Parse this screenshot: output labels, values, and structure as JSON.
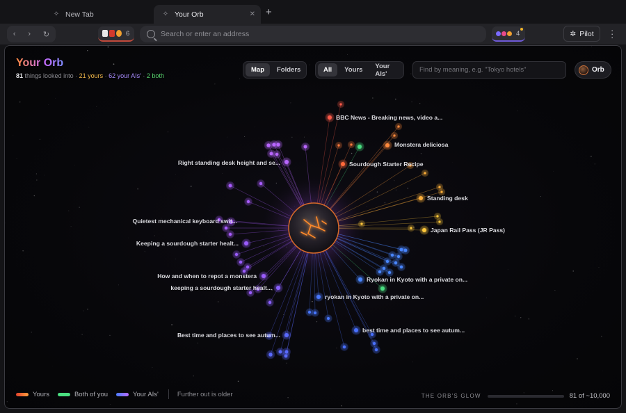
{
  "tabs": [
    {
      "label": "New Tab",
      "active": false,
      "icon": "sparkle-icon"
    },
    {
      "label": "Your Orb",
      "active": true,
      "icon": "sparkle-icon"
    }
  ],
  "toolbar": {
    "extension_count": "6",
    "address_placeholder": "Search or enter an address",
    "ai_count": "4",
    "pilot_label": "Pilot"
  },
  "header": {
    "title": "Your Orb",
    "count": "81",
    "count_label": "things looked into",
    "yours": "21 yours",
    "ais": "62 your AIs'",
    "both": "2 both"
  },
  "view_toggle": {
    "options": [
      "Map",
      "Folders"
    ],
    "selected": "Map"
  },
  "filter_toggle": {
    "options": [
      "All",
      "Yours",
      "Your AIs'"
    ],
    "selected": "All"
  },
  "search": {
    "placeholder": "Find by meaning, e.g. \"Tokyo hotels\""
  },
  "orb_button": {
    "label": "Orb"
  },
  "nodes": [
    {
      "label": "BBC News - Breaking news, video a...",
      "color": "#ff5a4a"
    },
    {
      "label": "Monstera deliciosa",
      "color": "#ff8a3d"
    },
    {
      "label": "Sourdough Starter Recipe",
      "color": "#ff6a3a"
    },
    {
      "label": "Standing desk",
      "color": "#ffb03a"
    },
    {
      "label": "Japan Rail Pass (JR Pass)",
      "color": "#ffc83a"
    },
    {
      "label": "Right standing desk height and se...",
      "color": "#b866ff"
    },
    {
      "label": "Quietest mechanical keyboard swit...",
      "color": "#a85cff"
    },
    {
      "label": "Keeping a sourdough starter healt...",
      "color": "#9a5cff"
    },
    {
      "label": "How and when to repot a monstera",
      "color": "#9a5cff"
    },
    {
      "label": "keeping a sourdough starter healt...",
      "color": "#8a60ff"
    },
    {
      "label": "Ryokan in Kyoto with a private on...",
      "color": "#4a86ff"
    },
    {
      "label": "ryokan in Kyoto with a private on...",
      "color": "#4a78ff"
    },
    {
      "label": "best time and places to see autum...",
      "color": "#4a70ff"
    },
    {
      "label": "Best time and places to see autum...",
      "color": "#5a6aff"
    }
  ],
  "legend": {
    "yours": "Yours",
    "both": "Both of you",
    "ais": "Your AIs'",
    "note": "Further out is older",
    "colors": {
      "yours": "#ff7a3d",
      "both": "#4ade80",
      "ais": "#8a7cff"
    }
  },
  "glow": {
    "label": "THE ORB'S GLOW",
    "count": "81 of ~10,000",
    "fraction": 0.0081
  }
}
